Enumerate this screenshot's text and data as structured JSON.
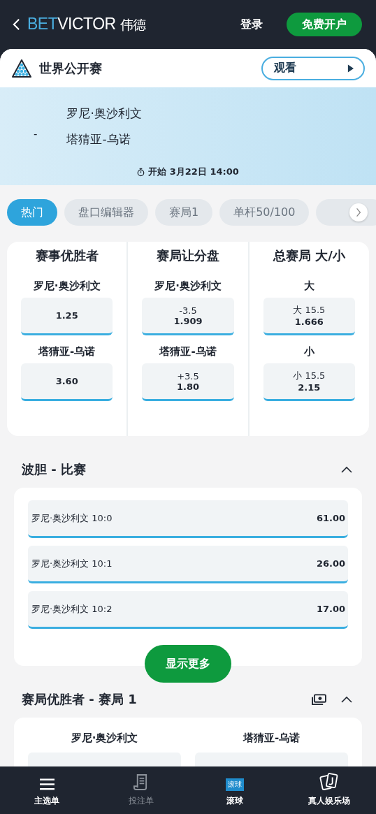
{
  "header": {
    "brand_primary": "BET",
    "brand_secondary": "VICTOR",
    "brand_cn": "伟德",
    "login": "登录",
    "signup": "免费开户"
  },
  "event": {
    "title": "世界公开赛",
    "watch": "观看",
    "separator": "-",
    "players": [
      "罗尼·奥沙利文",
      "塔猜亚-乌诺"
    ],
    "start": "开始 3月22日 14:00"
  },
  "tabs": [
    {
      "label": "热门",
      "selected": true
    },
    {
      "label": "盘口编辑器",
      "selected": false
    },
    {
      "label": "赛局1",
      "selected": false
    },
    {
      "label": "单杆50/100",
      "selected": false
    }
  ],
  "markets": [
    {
      "title": "赛事优胜者",
      "outcomes": [
        {
          "name": "罗尼·奥沙利文",
          "odds": "1.25"
        },
        {
          "name": "塔猜亚-乌诺",
          "odds": "3.60"
        }
      ]
    },
    {
      "title": "赛局让分盘",
      "outcomes": [
        {
          "name": "罗尼·奥沙利文",
          "line": "-3.5",
          "odds": "1.909"
        },
        {
          "name": "塔猜亚-乌诺",
          "line": "+3.5",
          "odds": "1.80"
        }
      ]
    },
    {
      "title": "总赛局 大/小",
      "outcomes": [
        {
          "name": "大",
          "line": "大 15.5",
          "odds": "1.666"
        },
        {
          "name": "小",
          "line": "小 15.5",
          "odds": "2.15"
        }
      ]
    }
  ],
  "correct_score": {
    "title": "波胆 - 比赛",
    "expanded": true,
    "rows": [
      {
        "label": "罗尼·奥沙利文 10:0",
        "odds": "61.00"
      },
      {
        "label": "罗尼·奥沙利文 10:1",
        "odds": "26.00"
      },
      {
        "label": "罗尼·奥沙利文 10:2",
        "odds": "17.00"
      }
    ],
    "show_more": "显示更多"
  },
  "frame_winner": {
    "title": "赛局优胜者 - 赛局 1",
    "expanded": true,
    "players": [
      "罗尼·奥沙利文",
      "塔猜亚-乌诺"
    ]
  },
  "bottom_nav": [
    {
      "kind": "menu",
      "label": "主选单",
      "disabled": false
    },
    {
      "kind": "betslip",
      "label": "投注单",
      "disabled": true
    },
    {
      "kind": "live",
      "label": "滚球",
      "badge": "滚球",
      "disabled": false
    },
    {
      "kind": "casino",
      "label": "真人娱乐场",
      "disabled": false
    }
  ]
}
